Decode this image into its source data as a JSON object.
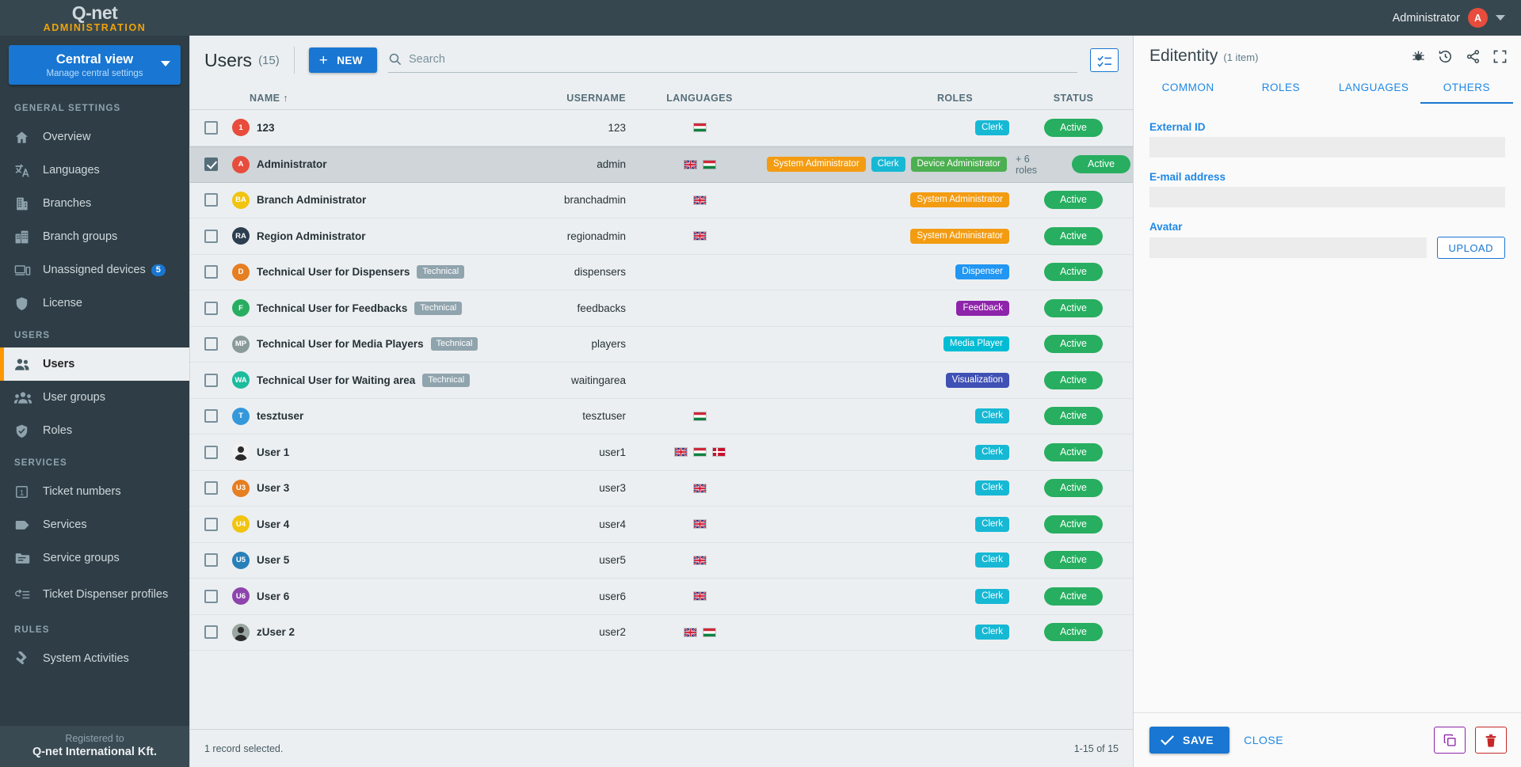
{
  "topbar": {
    "logo_main": "Q-net",
    "logo_sub": "ADMINISTRATION",
    "user_name": "Administrator",
    "user_initial": "A"
  },
  "sidebar": {
    "view_selector": {
      "title": "Central view",
      "subtitle": "Manage central settings"
    },
    "sections": [
      {
        "label": "GENERAL SETTINGS",
        "items": [
          {
            "label": "Overview",
            "icon": "home-icon",
            "active": false,
            "badge": ""
          },
          {
            "label": "Languages",
            "icon": "translate-icon",
            "active": false,
            "badge": ""
          },
          {
            "label": "Branches",
            "icon": "building-icon",
            "active": false,
            "badge": ""
          },
          {
            "label": "Branch groups",
            "icon": "buildings-icon",
            "active": false,
            "badge": ""
          },
          {
            "label": "Unassigned devices",
            "icon": "devices-icon",
            "active": false,
            "badge": "5"
          },
          {
            "label": "License",
            "icon": "shield-icon",
            "active": false,
            "badge": ""
          }
        ]
      },
      {
        "label": "USERS",
        "items": [
          {
            "label": "Users",
            "icon": "users-icon",
            "active": true,
            "badge": ""
          },
          {
            "label": "User groups",
            "icon": "user-groups-icon",
            "active": false,
            "badge": ""
          },
          {
            "label": "Roles",
            "icon": "shield-check-icon",
            "active": false,
            "badge": ""
          }
        ]
      },
      {
        "label": "SERVICES",
        "items": [
          {
            "label": "Ticket numbers",
            "icon": "ticket-number-icon",
            "active": false,
            "badge": ""
          },
          {
            "label": "Services",
            "icon": "tag-icon",
            "active": false,
            "badge": ""
          },
          {
            "label": "Service groups",
            "icon": "folder-icon",
            "active": false,
            "badge": ""
          },
          {
            "label": "Ticket Dispenser profiles",
            "icon": "dispenser-icon",
            "active": false,
            "badge": ""
          }
        ]
      },
      {
        "label": "RULES",
        "items": [
          {
            "label": "System Activities",
            "icon": "gavel-icon",
            "active": false,
            "badge": ""
          }
        ]
      }
    ],
    "footer": {
      "registered_to": "Registered to",
      "company": "Q-net International Kft."
    }
  },
  "main": {
    "title": "Users",
    "count": "(15)",
    "new_button": "NEW",
    "search_placeholder": "Search",
    "search_value": "",
    "columns": [
      "NAME",
      "USERNAME",
      "LANGUAGES",
      "ROLES",
      "STATUS"
    ],
    "sort_column": "NAME",
    "sort_direction": "asc",
    "footer_left": "1 record selected.",
    "footer_right": "1-15 of 15",
    "rows": [
      {
        "checked": false,
        "name": "123",
        "technical": "",
        "username": "123",
        "avatar_text": "1",
        "avatar_color": "#e74c3c",
        "avatar_img": "",
        "languages": [
          "hu"
        ],
        "roles": [
          {
            "label": "Clerk",
            "color": "#17b8d4"
          }
        ],
        "more_roles": "",
        "status": "Active"
      },
      {
        "checked": true,
        "name": "Administrator",
        "technical": "",
        "username": "admin",
        "avatar_text": "A",
        "avatar_color": "#e74c3c",
        "avatar_img": "",
        "languages": [
          "gb",
          "hu"
        ],
        "roles": [
          {
            "label": "System Administrator",
            "color": "#f39c12"
          },
          {
            "label": "Clerk",
            "color": "#17b8d4"
          },
          {
            "label": "Device Administrator",
            "color": "#4caf50"
          }
        ],
        "more_roles": "+ 6 roles",
        "status": "Active"
      },
      {
        "checked": false,
        "name": "Branch Administrator",
        "technical": "",
        "username": "branchadmin",
        "avatar_text": "BA",
        "avatar_color": "#f1c40f",
        "avatar_img": "",
        "languages": [
          "gb"
        ],
        "roles": [
          {
            "label": "System Administrator",
            "color": "#f39c12"
          }
        ],
        "more_roles": "",
        "status": "Active"
      },
      {
        "checked": false,
        "name": "Region Administrator",
        "technical": "",
        "username": "regionadmin",
        "avatar_text": "RA",
        "avatar_color": "#2c3e50",
        "avatar_img": "",
        "languages": [
          "gb"
        ],
        "roles": [
          {
            "label": "System Administrator",
            "color": "#f39c12"
          }
        ],
        "more_roles": "",
        "status": "Active"
      },
      {
        "checked": false,
        "name": "Technical User for Dispensers",
        "technical": "Technical",
        "username": "dispensers",
        "avatar_text": "D",
        "avatar_color": "#e67e22",
        "avatar_img": "",
        "languages": [],
        "roles": [
          {
            "label": "Dispenser",
            "color": "#2196f3"
          }
        ],
        "more_roles": "",
        "status": "Active"
      },
      {
        "checked": false,
        "name": "Technical User for Feedbacks",
        "technical": "Technical",
        "username": "feedbacks",
        "avatar_text": "F",
        "avatar_color": "#27ae60",
        "avatar_img": "",
        "languages": [],
        "roles": [
          {
            "label": "Feedback",
            "color": "#8e24aa"
          }
        ],
        "more_roles": "",
        "status": "Active"
      },
      {
        "checked": false,
        "name": "Technical User for Media Players",
        "technical": "Technical",
        "username": "players",
        "avatar_text": "MP",
        "avatar_color": "#8a9a9a",
        "avatar_img": "",
        "languages": [],
        "roles": [
          {
            "label": "Media Player",
            "color": "#00bcd4"
          }
        ],
        "more_roles": "",
        "status": "Active"
      },
      {
        "checked": false,
        "name": "Technical User for Waiting area",
        "technical": "Technical",
        "username": "waitingarea",
        "avatar_text": "WA",
        "avatar_color": "#1abc9c",
        "avatar_img": "",
        "languages": [],
        "roles": [
          {
            "label": "Visualization",
            "color": "#3f51b5"
          }
        ],
        "more_roles": "",
        "status": "Active"
      },
      {
        "checked": false,
        "name": "tesztuser",
        "technical": "",
        "username": "tesztuser",
        "avatar_text": "T",
        "avatar_color": "#3498db",
        "avatar_img": "",
        "languages": [
          "hu"
        ],
        "roles": [
          {
            "label": "Clerk",
            "color": "#17b8d4"
          }
        ],
        "more_roles": "",
        "status": "Active"
      },
      {
        "checked": false,
        "name": "User 1",
        "technical": "",
        "username": "user1",
        "avatar_text": "",
        "avatar_color": "#ffffff",
        "avatar_img": "photo",
        "languages": [
          "gb",
          "hu",
          "dk"
        ],
        "roles": [
          {
            "label": "Clerk",
            "color": "#17b8d4"
          }
        ],
        "more_roles": "",
        "status": "Active"
      },
      {
        "checked": false,
        "name": "User 3",
        "technical": "",
        "username": "user3",
        "avatar_text": "U3",
        "avatar_color": "#e67e22",
        "avatar_img": "",
        "languages": [
          "gb"
        ],
        "roles": [
          {
            "label": "Clerk",
            "color": "#17b8d4"
          }
        ],
        "more_roles": "",
        "status": "Active"
      },
      {
        "checked": false,
        "name": "User 4",
        "technical": "",
        "username": "user4",
        "avatar_text": "U4",
        "avatar_color": "#f1c40f",
        "avatar_img": "",
        "languages": [
          "gb"
        ],
        "roles": [
          {
            "label": "Clerk",
            "color": "#17b8d4"
          }
        ],
        "more_roles": "",
        "status": "Active"
      },
      {
        "checked": false,
        "name": "User 5",
        "technical": "",
        "username": "user5",
        "avatar_text": "U5",
        "avatar_color": "#2980b9",
        "avatar_img": "",
        "languages": [
          "gb"
        ],
        "roles": [
          {
            "label": "Clerk",
            "color": "#17b8d4"
          }
        ],
        "more_roles": "",
        "status": "Active"
      },
      {
        "checked": false,
        "name": "User 6",
        "technical": "",
        "username": "user6",
        "avatar_text": "U6",
        "avatar_color": "#8e44ad",
        "avatar_img": "",
        "languages": [
          "gb"
        ],
        "roles": [
          {
            "label": "Clerk",
            "color": "#17b8d4"
          }
        ],
        "more_roles": "",
        "status": "Active"
      },
      {
        "checked": false,
        "name": "zUser 2",
        "technical": "",
        "username": "user2",
        "avatar_text": "",
        "avatar_color": "#7f8c8d",
        "avatar_img": "photo2",
        "languages": [
          "gb",
          "hu"
        ],
        "roles": [
          {
            "label": "Clerk",
            "color": "#17b8d4"
          }
        ],
        "more_roles": "",
        "status": "Active"
      }
    ]
  },
  "panel": {
    "title": "Editentity",
    "count": "(1 item)",
    "tabs": [
      {
        "label": "COMMON",
        "active": false
      },
      {
        "label": "ROLES",
        "active": false
      },
      {
        "label": "LANGUAGES",
        "active": false
      },
      {
        "label": "OTHERS",
        "active": true
      }
    ],
    "fields": {
      "external_id_label": "External ID",
      "external_id_value": "",
      "email_label": "E-mail address",
      "email_value": "",
      "avatar_label": "Avatar",
      "avatar_value": "",
      "upload_button": "UPLOAD"
    },
    "footer": {
      "save": "SAVE",
      "close": "CLOSE"
    }
  },
  "colors": {
    "brand_blue": "#1976d2",
    "accent_orange": "#ff9800",
    "sidebar_bg": "#2f3e46",
    "topbar_bg": "#37474f",
    "status_green": "#27ae60"
  }
}
